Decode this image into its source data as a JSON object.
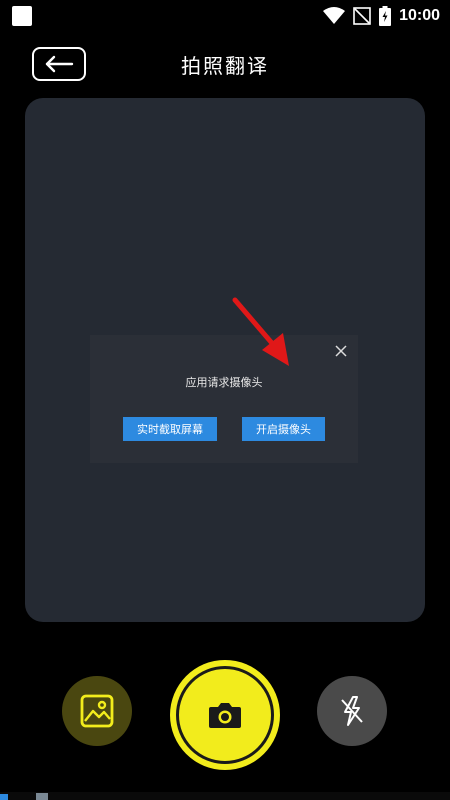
{
  "status_bar": {
    "time": "10:00",
    "icons": [
      "notification-square-icon",
      "wifi-icon",
      "no-signal-icon",
      "battery-charging-icon"
    ]
  },
  "header": {
    "title": "拍照翻译",
    "back_icon": "arrow-left-icon"
  },
  "dialog": {
    "message": "应用请求摄像头",
    "screen_capture_label": "实时截取屏幕",
    "open_camera_label": "开启摄像头",
    "close_icon": "close-icon"
  },
  "bottom_controls": {
    "gallery_icon": "image-icon",
    "shutter_icon": "camera-icon",
    "flash_icon": "flash-off-icon"
  },
  "colors": {
    "accent_yellow": "#f2ec1c",
    "dialog_button": "#2d8ae0",
    "panel": "#252a33",
    "arrow": "#e01818"
  }
}
